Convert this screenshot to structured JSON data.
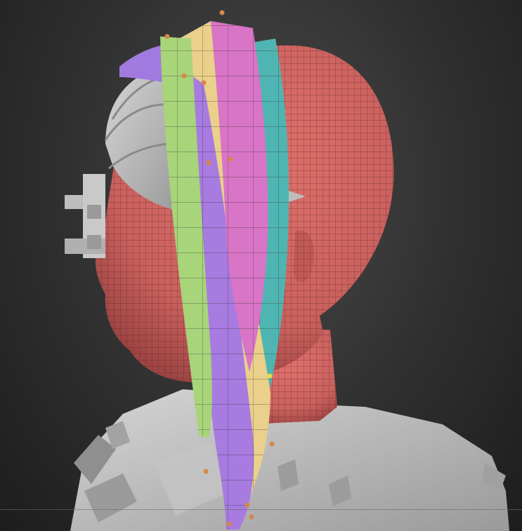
{
  "colors": {
    "background": "#2f2f2f",
    "head_mesh": "#d0625f",
    "mesh_lines": "#5a1f1f",
    "clay_gray": "#b9b9b9",
    "strand_green": "#a8d47a",
    "strand_purple": "#a77be0",
    "strand_pink": "#d975c6",
    "strand_teal": "#4fb5b2",
    "strand_yellow": "#ead08a",
    "control_point": "#d4884a"
  },
  "objects": {
    "head": "head-mesh",
    "hair": [
      "green-strand",
      "purple-strand",
      "pink-strand",
      "teal-strand",
      "yellow-strand"
    ],
    "accessories": [
      "hair-bun-gray",
      "side-clip-gray",
      "body-armor-gray"
    ]
  }
}
